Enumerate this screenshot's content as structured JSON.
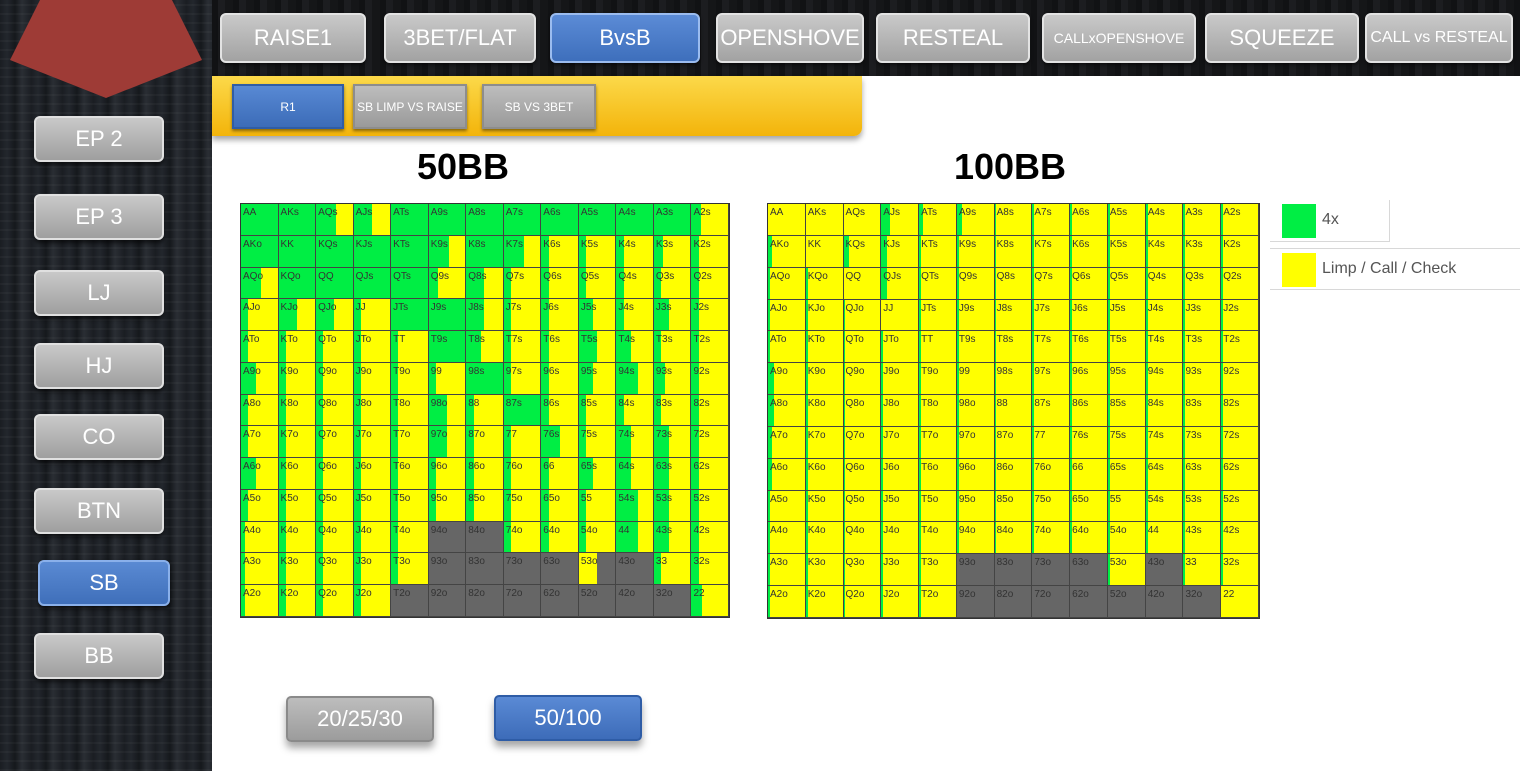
{
  "sidebar": {
    "items": [
      {
        "label": "EP 2",
        "active": false
      },
      {
        "label": "EP 3",
        "active": false
      },
      {
        "label": "LJ",
        "active": false
      },
      {
        "label": "HJ",
        "active": false
      },
      {
        "label": "CO",
        "active": false
      },
      {
        "label": "BTN",
        "active": false
      },
      {
        "label": "SB",
        "active": true
      },
      {
        "label": "BB",
        "active": false
      }
    ],
    "logo_color": "#9e3b36"
  },
  "top_tabs": [
    {
      "label": "RAISE1",
      "active": false
    },
    {
      "label": "3BET/FLAT",
      "active": false
    },
    {
      "label": "BvsB",
      "active": true
    },
    {
      "label": "OPENSHOVE",
      "active": false
    },
    {
      "label": "RESTEAL",
      "active": false
    },
    {
      "label": "CALLxOPENSHOVE",
      "active": false
    },
    {
      "label": "SQUEEZE",
      "active": false
    },
    {
      "label": "CALL vs RESTEAL",
      "active": false
    }
  ],
  "sub_tabs": [
    {
      "label": "R1",
      "active": true
    },
    {
      "label": "SB LIMP VS RAISE",
      "active": false
    },
    {
      "label": "SB VS 3BET",
      "active": false
    }
  ],
  "colors": {
    "raise": "#00ee44",
    "limp": "#ffff00",
    "fold": "#666666",
    "accent_blue": "#4a7bc8",
    "subbar_yellow": "#f7c21f"
  },
  "grids": [
    {
      "title": "50BB",
      "rows": [
        [
          "AA",
          "AKs",
          "AQs",
          "AJs",
          "ATs",
          "A9s",
          "A8s",
          "A7s",
          "A6s",
          "A5s",
          "A4s",
          "A3s",
          "A2s"
        ],
        [
          "AKo",
          "KK",
          "KQs",
          "KJs",
          "KTs",
          "K9s",
          "K8s",
          "K7s",
          "K6s",
          "K5s",
          "K4s",
          "K3s",
          "K2s"
        ],
        [
          "AQo",
          "KQo",
          "QQ",
          "QJs",
          "QTs",
          "Q9s",
          "Q8s",
          "Q7s",
          "Q6s",
          "Q5s",
          "Q4s",
          "Q3s",
          "Q2s"
        ],
        [
          "AJo",
          "KJo",
          "QJo",
          "JJ",
          "JTs",
          "J9s",
          "J8s",
          "J7s",
          "J6s",
          "J5s",
          "J4s",
          "J3s",
          "J2s"
        ],
        [
          "ATo",
          "KTo",
          "QTo",
          "JTo",
          "TT",
          "T9s",
          "T8s",
          "T7s",
          "T6s",
          "T5s",
          "T4s",
          "T3s",
          "T2s"
        ],
        [
          "A9o",
          "K9o",
          "Q9o",
          "J9o",
          "T9o",
          "99",
          "98s",
          "97s",
          "96s",
          "95s",
          "94s",
          "93s",
          "92s"
        ],
        [
          "A8o",
          "K8o",
          "Q8o",
          "J8o",
          "T8o",
          "98o",
          "88",
          "87s",
          "86s",
          "85s",
          "84s",
          "83s",
          "82s"
        ],
        [
          "A7o",
          "K7o",
          "Q7o",
          "J7o",
          "T7o",
          "97o",
          "87o",
          "77",
          "76s",
          "75s",
          "74s",
          "73s",
          "72s"
        ],
        [
          "A6o",
          "K6o",
          "Q6o",
          "J6o",
          "T6o",
          "96o",
          "86o",
          "76o",
          "66",
          "65s",
          "64s",
          "63s",
          "62s"
        ],
        [
          "A5o",
          "K5o",
          "Q5o",
          "J5o",
          "T5o",
          "95o",
          "85o",
          "75o",
          "65o",
          "55",
          "54s",
          "53s",
          "52s"
        ],
        [
          "A4o",
          "K4o",
          "Q4o",
          "J4o",
          "T4o",
          "94o",
          "84o",
          "74o",
          "64o",
          "54o",
          "44",
          "43s",
          "42s"
        ],
        [
          "A3o",
          "K3o",
          "Q3o",
          "J3o",
          "T3o",
          "93o",
          "83o",
          "73o",
          "63o",
          "53o",
          "43o",
          "33",
          "32s"
        ],
        [
          "A2o",
          "K2o",
          "Q2o",
          "J2o",
          "T2o",
          "92o",
          "82o",
          "72o",
          "62o",
          "52o",
          "42o",
          "32o",
          "22"
        ]
      ],
      "raise_freq": [
        [
          100,
          100,
          55,
          50,
          100,
          100,
          100,
          100,
          100,
          100,
          100,
          100,
          25
        ],
        [
          100,
          100,
          100,
          100,
          100,
          55,
          100,
          55,
          20,
          20,
          20,
          25,
          20
        ],
        [
          55,
          100,
          100,
          100,
          100,
          25,
          50,
          20,
          20,
          20,
          20,
          20,
          20
        ],
        [
          20,
          50,
          50,
          20,
          100,
          100,
          50,
          20,
          20,
          40,
          20,
          40,
          20
        ],
        [
          20,
          20,
          20,
          20,
          20,
          100,
          40,
          20,
          20,
          50,
          40,
          20,
          20
        ],
        [
          40,
          20,
          20,
          20,
          20,
          20,
          100,
          20,
          20,
          40,
          60,
          30,
          20
        ],
        [
          20,
          20,
          20,
          20,
          20,
          50,
          20,
          100,
          20,
          20,
          20,
          20,
          20
        ],
        [
          20,
          20,
          20,
          20,
          20,
          50,
          20,
          20,
          50,
          20,
          40,
          40,
          20
        ],
        [
          40,
          20,
          20,
          20,
          20,
          20,
          20,
          20,
          20,
          40,
          40,
          40,
          20
        ],
        [
          20,
          20,
          20,
          20,
          20,
          20,
          20,
          20,
          20,
          20,
          60,
          40,
          20
        ],
        [
          10,
          20,
          20,
          20,
          20,
          0,
          0,
          20,
          20,
          20,
          60,
          40,
          20
        ],
        [
          10,
          20,
          20,
          20,
          20,
          0,
          0,
          0,
          0,
          0,
          0,
          20,
          20
        ],
        [
          10,
          20,
          20,
          20,
          0,
          0,
          0,
          0,
          0,
          0,
          0,
          0,
          30
        ]
      ],
      "fold": [
        [
          0,
          0,
          0,
          0,
          0,
          0,
          0,
          0,
          0,
          0,
          0,
          0,
          0
        ],
        [
          0,
          0,
          0,
          0,
          0,
          0,
          0,
          0,
          0,
          0,
          0,
          0,
          0
        ],
        [
          0,
          0,
          0,
          0,
          0,
          0,
          0,
          0,
          0,
          0,
          0,
          0,
          0
        ],
        [
          0,
          0,
          0,
          0,
          0,
          0,
          0,
          0,
          0,
          0,
          0,
          0,
          0
        ],
        [
          0,
          0,
          0,
          0,
          0,
          0,
          0,
          0,
          0,
          0,
          0,
          0,
          0
        ],
        [
          0,
          0,
          0,
          0,
          0,
          0,
          0,
          0,
          0,
          0,
          0,
          0,
          0
        ],
        [
          0,
          0,
          0,
          0,
          0,
          0,
          0,
          0,
          0,
          0,
          0,
          0,
          0
        ],
        [
          0,
          0,
          0,
          0,
          0,
          0,
          0,
          0,
          0,
          0,
          0,
          0,
          0
        ],
        [
          0,
          0,
          0,
          0,
          0,
          0,
          0,
          0,
          0,
          0,
          0,
          0,
          0
        ],
        [
          0,
          0,
          0,
          0,
          0,
          0,
          0,
          0,
          0,
          0,
          0,
          0,
          0
        ],
        [
          0,
          0,
          0,
          0,
          0,
          1,
          1,
          0,
          0,
          0,
          0,
          0,
          0
        ],
        [
          0,
          0,
          0,
          0,
          0,
          1,
          1,
          1,
          1,
          0.5,
          1,
          0,
          0
        ],
        [
          0,
          0,
          0,
          0,
          1,
          1,
          1,
          1,
          1,
          1,
          1,
          1,
          0
        ]
      ]
    },
    {
      "title": "100BB",
      "rows": [
        [
          "AA",
          "AKs",
          "AQs",
          "AJs",
          "ATs",
          "A9s",
          "A8s",
          "A7s",
          "A6s",
          "A5s",
          "A4s",
          "A3s",
          "A2s"
        ],
        [
          "AKo",
          "KK",
          "KQs",
          "KJs",
          "KTs",
          "K9s",
          "K8s",
          "K7s",
          "K6s",
          "K5s",
          "K4s",
          "K3s",
          "K2s"
        ],
        [
          "AQo",
          "KQo",
          "QQ",
          "QJs",
          "QTs",
          "Q9s",
          "Q8s",
          "Q7s",
          "Q6s",
          "Q5s",
          "Q4s",
          "Q3s",
          "Q2s"
        ],
        [
          "AJo",
          "KJo",
          "QJo",
          "JJ",
          "JTs",
          "J9s",
          "J8s",
          "J7s",
          "J6s",
          "J5s",
          "J4s",
          "J3s",
          "J2s"
        ],
        [
          "ATo",
          "KTo",
          "QTo",
          "JTo",
          "TT",
          "T9s",
          "T8s",
          "T7s",
          "T6s",
          "T5s",
          "T4s",
          "T3s",
          "T2s"
        ],
        [
          "A9o",
          "K9o",
          "Q9o",
          "J9o",
          "T9o",
          "99",
          "98s",
          "97s",
          "96s",
          "95s",
          "94s",
          "93s",
          "92s"
        ],
        [
          "A8o",
          "K8o",
          "Q8o",
          "J8o",
          "T8o",
          "98o",
          "88",
          "87s",
          "86s",
          "85s",
          "84s",
          "83s",
          "82s"
        ],
        [
          "A7o",
          "K7o",
          "Q7o",
          "J7o",
          "T7o",
          "97o",
          "87o",
          "77",
          "76s",
          "75s",
          "74s",
          "73s",
          "72s"
        ],
        [
          "A6o",
          "K6o",
          "Q6o",
          "J6o",
          "T6o",
          "96o",
          "86o",
          "76o",
          "66",
          "65s",
          "64s",
          "63s",
          "62s"
        ],
        [
          "A5o",
          "K5o",
          "Q5o",
          "J5o",
          "T5o",
          "95o",
          "85o",
          "75o",
          "65o",
          "55",
          "54s",
          "53s",
          "52s"
        ],
        [
          "A4o",
          "K4o",
          "Q4o",
          "J4o",
          "T4o",
          "94o",
          "84o",
          "74o",
          "64o",
          "54o",
          "44",
          "43s",
          "42s"
        ],
        [
          "A3o",
          "K3o",
          "Q3o",
          "J3o",
          "T3o",
          "93o",
          "83o",
          "73o",
          "63o",
          "53o",
          "43o",
          "33",
          "32s"
        ],
        [
          "A2o",
          "K2o",
          "Q2o",
          "J2o",
          "T2o",
          "92o",
          "82o",
          "72o",
          "62o",
          "52o",
          "42o",
          "32o",
          "22"
        ]
      ],
      "raise_freq": [
        [
          0,
          0,
          0,
          25,
          10,
          15,
          5,
          5,
          5,
          5,
          5,
          5,
          5
        ],
        [
          10,
          0,
          15,
          15,
          5,
          5,
          5,
          5,
          5,
          5,
          5,
          5,
          5
        ],
        [
          5,
          5,
          0,
          15,
          5,
          5,
          5,
          5,
          5,
          5,
          5,
          5,
          5
        ],
        [
          5,
          5,
          5,
          0,
          5,
          5,
          5,
          5,
          5,
          5,
          5,
          5,
          5
        ],
        [
          5,
          5,
          5,
          5,
          5,
          5,
          5,
          5,
          5,
          5,
          5,
          5,
          5
        ],
        [
          15,
          5,
          5,
          5,
          5,
          5,
          5,
          5,
          5,
          5,
          5,
          5,
          5
        ],
        [
          15,
          5,
          5,
          5,
          5,
          5,
          5,
          5,
          5,
          5,
          5,
          5,
          5
        ],
        [
          10,
          5,
          5,
          5,
          5,
          5,
          5,
          5,
          5,
          5,
          5,
          5,
          5
        ],
        [
          10,
          5,
          5,
          5,
          5,
          5,
          5,
          5,
          5,
          5,
          5,
          5,
          5
        ],
        [
          5,
          5,
          5,
          5,
          5,
          5,
          5,
          5,
          5,
          5,
          5,
          5,
          5
        ],
        [
          5,
          5,
          5,
          5,
          5,
          5,
          5,
          5,
          5,
          5,
          5,
          5,
          5
        ],
        [
          5,
          5,
          5,
          5,
          5,
          0,
          0,
          0,
          0,
          5,
          0,
          5,
          5
        ],
        [
          5,
          5,
          5,
          5,
          5,
          0,
          0,
          0,
          0,
          0,
          0,
          0,
          0
        ]
      ],
      "fold": [
        [
          0,
          0,
          0,
          0,
          0,
          0,
          0,
          0,
          0,
          0,
          0,
          0,
          0
        ],
        [
          0,
          0,
          0,
          0,
          0,
          0,
          0,
          0,
          0,
          0,
          0,
          0,
          0
        ],
        [
          0,
          0,
          0,
          0,
          0,
          0,
          0,
          0,
          0,
          0,
          0,
          0,
          0
        ],
        [
          0,
          0,
          0,
          0,
          0,
          0,
          0,
          0,
          0,
          0,
          0,
          0,
          0
        ],
        [
          0,
          0,
          0,
          0,
          0,
          0,
          0,
          0,
          0,
          0,
          0,
          0,
          0
        ],
        [
          0,
          0,
          0,
          0,
          0,
          0,
          0,
          0,
          0,
          0,
          0,
          0,
          0
        ],
        [
          0,
          0,
          0,
          0,
          0,
          0,
          0,
          0,
          0,
          0,
          0,
          0,
          0
        ],
        [
          0,
          0,
          0,
          0,
          0,
          0,
          0,
          0,
          0,
          0,
          0,
          0,
          0
        ],
        [
          0,
          0,
          0,
          0,
          0,
          0,
          0,
          0,
          0,
          0,
          0,
          0,
          0
        ],
        [
          0,
          0,
          0,
          0,
          0,
          0,
          0,
          0,
          0,
          0,
          0,
          0,
          0
        ],
        [
          0,
          0,
          0,
          0,
          0,
          0,
          0,
          0,
          0,
          0,
          0,
          0,
          0
        ],
        [
          0,
          0,
          0,
          0,
          0,
          1,
          1,
          1,
          1,
          0,
          1,
          0,
          0
        ],
        [
          0,
          0,
          0,
          0,
          0,
          1,
          1,
          1,
          1,
          1,
          1,
          1,
          0
        ]
      ]
    }
  ],
  "legend": [
    {
      "label": "4x",
      "color": "#00ee44"
    },
    {
      "label": "Limp / Call / Check",
      "color": "#ffff00"
    }
  ],
  "stack_buttons": [
    {
      "label": "20/25/30",
      "active": false
    },
    {
      "label": "50/100",
      "active": true
    }
  ]
}
